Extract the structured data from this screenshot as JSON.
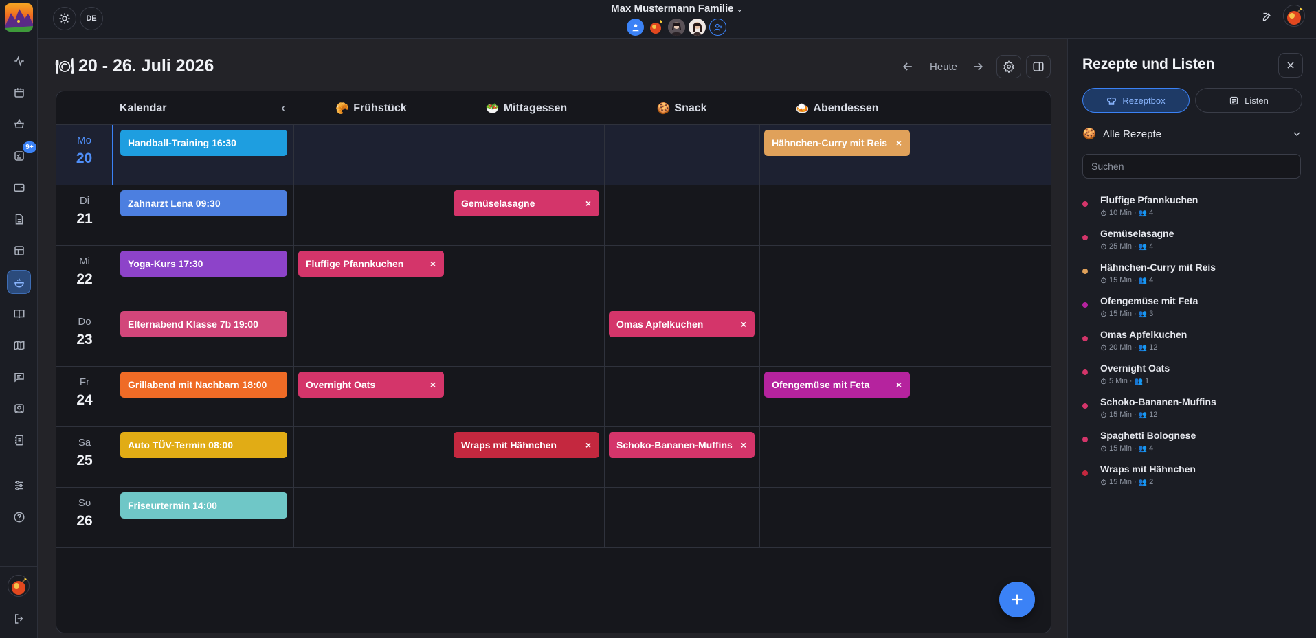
{
  "topbar": {
    "lang": "DE",
    "family_name": "Max Mustermann Familie"
  },
  "header": {
    "date_range": "20 - 26. Juli 2026",
    "today_label": "Heute"
  },
  "calendar": {
    "columns": [
      "Kalendar",
      "Frühstück",
      "Mittagessen",
      "Snack",
      "Abendessen"
    ],
    "column_icons": [
      "",
      "croissant-icon",
      "salad-icon",
      "cookie-icon",
      "curry-icon"
    ],
    "days": [
      {
        "name": "Mo",
        "num": "20"
      },
      {
        "name": "Di",
        "num": "21"
      },
      {
        "name": "Mi",
        "num": "22"
      },
      {
        "name": "Do",
        "num": "23"
      },
      {
        "name": "Fr",
        "num": "24"
      },
      {
        "name": "Sa",
        "num": "25"
      },
      {
        "name": "So",
        "num": "26"
      }
    ],
    "events": [
      {
        "label": "Handball-Training 16:30",
        "color": "#1e9ee0"
      },
      {
        "label": "Zahnarzt Lena 09:30",
        "color": "#4c7fe0"
      },
      {
        "label": "Yoga-Kurs 17:30",
        "color": "#8d43c9"
      },
      {
        "label": "Elternabend Klasse 7b 19:00",
        "color": "#d2467a"
      },
      {
        "label": "Grillabend mit Nachbarn 18:00",
        "color": "#ef6b26"
      },
      {
        "label": "Auto TÜV-Termin 08:00",
        "color": "#e1ac15"
      },
      {
        "label": "Friseurtermin 14:00",
        "color": "#6fc7c7"
      }
    ],
    "meals": [
      {
        "day": 0,
        "slot": 4,
        "label": "Hähnchen-Curry mit Reis",
        "color": "#e0a15a"
      },
      {
        "day": 1,
        "slot": 2,
        "label": "Gemüselasagne",
        "color": "#d4356a"
      },
      {
        "day": 2,
        "slot": 1,
        "label": "Fluffige Pfannkuchen",
        "color": "#d4356a"
      },
      {
        "day": 3,
        "slot": 3,
        "label": "Omas Apfelkuchen",
        "color": "#d4356a"
      },
      {
        "day": 4,
        "slot": 1,
        "label": "Overnight Oats",
        "color": "#d4356a"
      },
      {
        "day": 4,
        "slot": 4,
        "label": "Ofengemüse mit Feta",
        "color": "#b5239e"
      },
      {
        "day": 5,
        "slot": 2,
        "label": "Wraps mit Hähnchen",
        "color": "#c4283f"
      },
      {
        "day": 5,
        "slot": 3,
        "label": "Schoko-Bananen-Muffins",
        "color": "#d4356a"
      }
    ],
    "remove_glyph": "×"
  },
  "rail": {
    "badge": "9+",
    "items": [
      "activity-icon",
      "calendar-icon",
      "basket-icon",
      "tasks-icon",
      "wallet-icon",
      "document-icon",
      "table-icon",
      "meal-icon",
      "book-icon",
      "map-icon",
      "chat-icon",
      "photo-icon",
      "notebook-icon",
      "settings-sliders-icon",
      "help-icon",
      "logout-icon"
    ]
  },
  "panel": {
    "title": "Rezepte und Listen",
    "tab_recipes": "Rezeptbox",
    "tab_lists": "Listen",
    "filter_label": "Alle Rezepte",
    "search_placeholder": "Suchen",
    "recipes": [
      {
        "name": "Fluffige Pfannkuchen",
        "time": "10 Min",
        "servings": "4",
        "color": "#d4356a"
      },
      {
        "name": "Gemüselasagne",
        "time": "25 Min",
        "servings": "4",
        "color": "#d4356a"
      },
      {
        "name": "Hähnchen-Curry mit Reis",
        "time": "15 Min",
        "servings": "4",
        "color": "#e0a15a"
      },
      {
        "name": "Ofengemüse mit Feta",
        "time": "15 Min",
        "servings": "3",
        "color": "#b5239e"
      },
      {
        "name": "Omas Apfelkuchen",
        "time": "20 Min",
        "servings": "12",
        "color": "#d4356a"
      },
      {
        "name": "Overnight Oats",
        "time": "5 Min",
        "servings": "1",
        "color": "#d4356a"
      },
      {
        "name": "Schoko-Bananen-Muffins",
        "time": "15 Min",
        "servings": "12",
        "color": "#d4356a"
      },
      {
        "name": "Spaghetti Bolognese",
        "time": "15 Min",
        "servings": "4",
        "color": "#d4356a"
      },
      {
        "name": "Wraps mit Hähnchen",
        "time": "15 Min",
        "servings": "2",
        "color": "#c4283f"
      }
    ],
    "meta_separator": "·"
  }
}
